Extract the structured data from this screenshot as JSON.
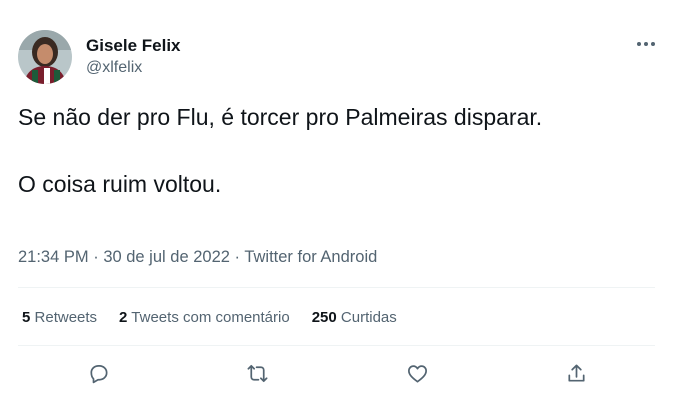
{
  "user": {
    "name": "Gisele Felix",
    "handle": "@xlfelix",
    "avatar_icon": "profile-photo"
  },
  "tweet": {
    "line1": "Se não der pro Flu, é torcer pro Palmeiras disparar.",
    "line2": "O coisa ruim voltou."
  },
  "meta": {
    "time": "21:34 PM",
    "date": "30 de jul de 2022",
    "separator": "·",
    "source": "Twitter for Android"
  },
  "stats": {
    "retweets_count": "5",
    "retweets_label": "Retweets",
    "quotes_count": "2",
    "quotes_label": "Tweets com comentário",
    "likes_count": "250",
    "likes_label": "Curtidas"
  },
  "icons": {
    "more": "more-horizontal-icon",
    "reply": "reply-icon",
    "retweet": "retweet-icon",
    "like": "heart-icon",
    "share": "share-icon"
  },
  "colors": {
    "text": "#0f1419",
    "secondary": "#536471",
    "divider": "#eff3f4"
  }
}
